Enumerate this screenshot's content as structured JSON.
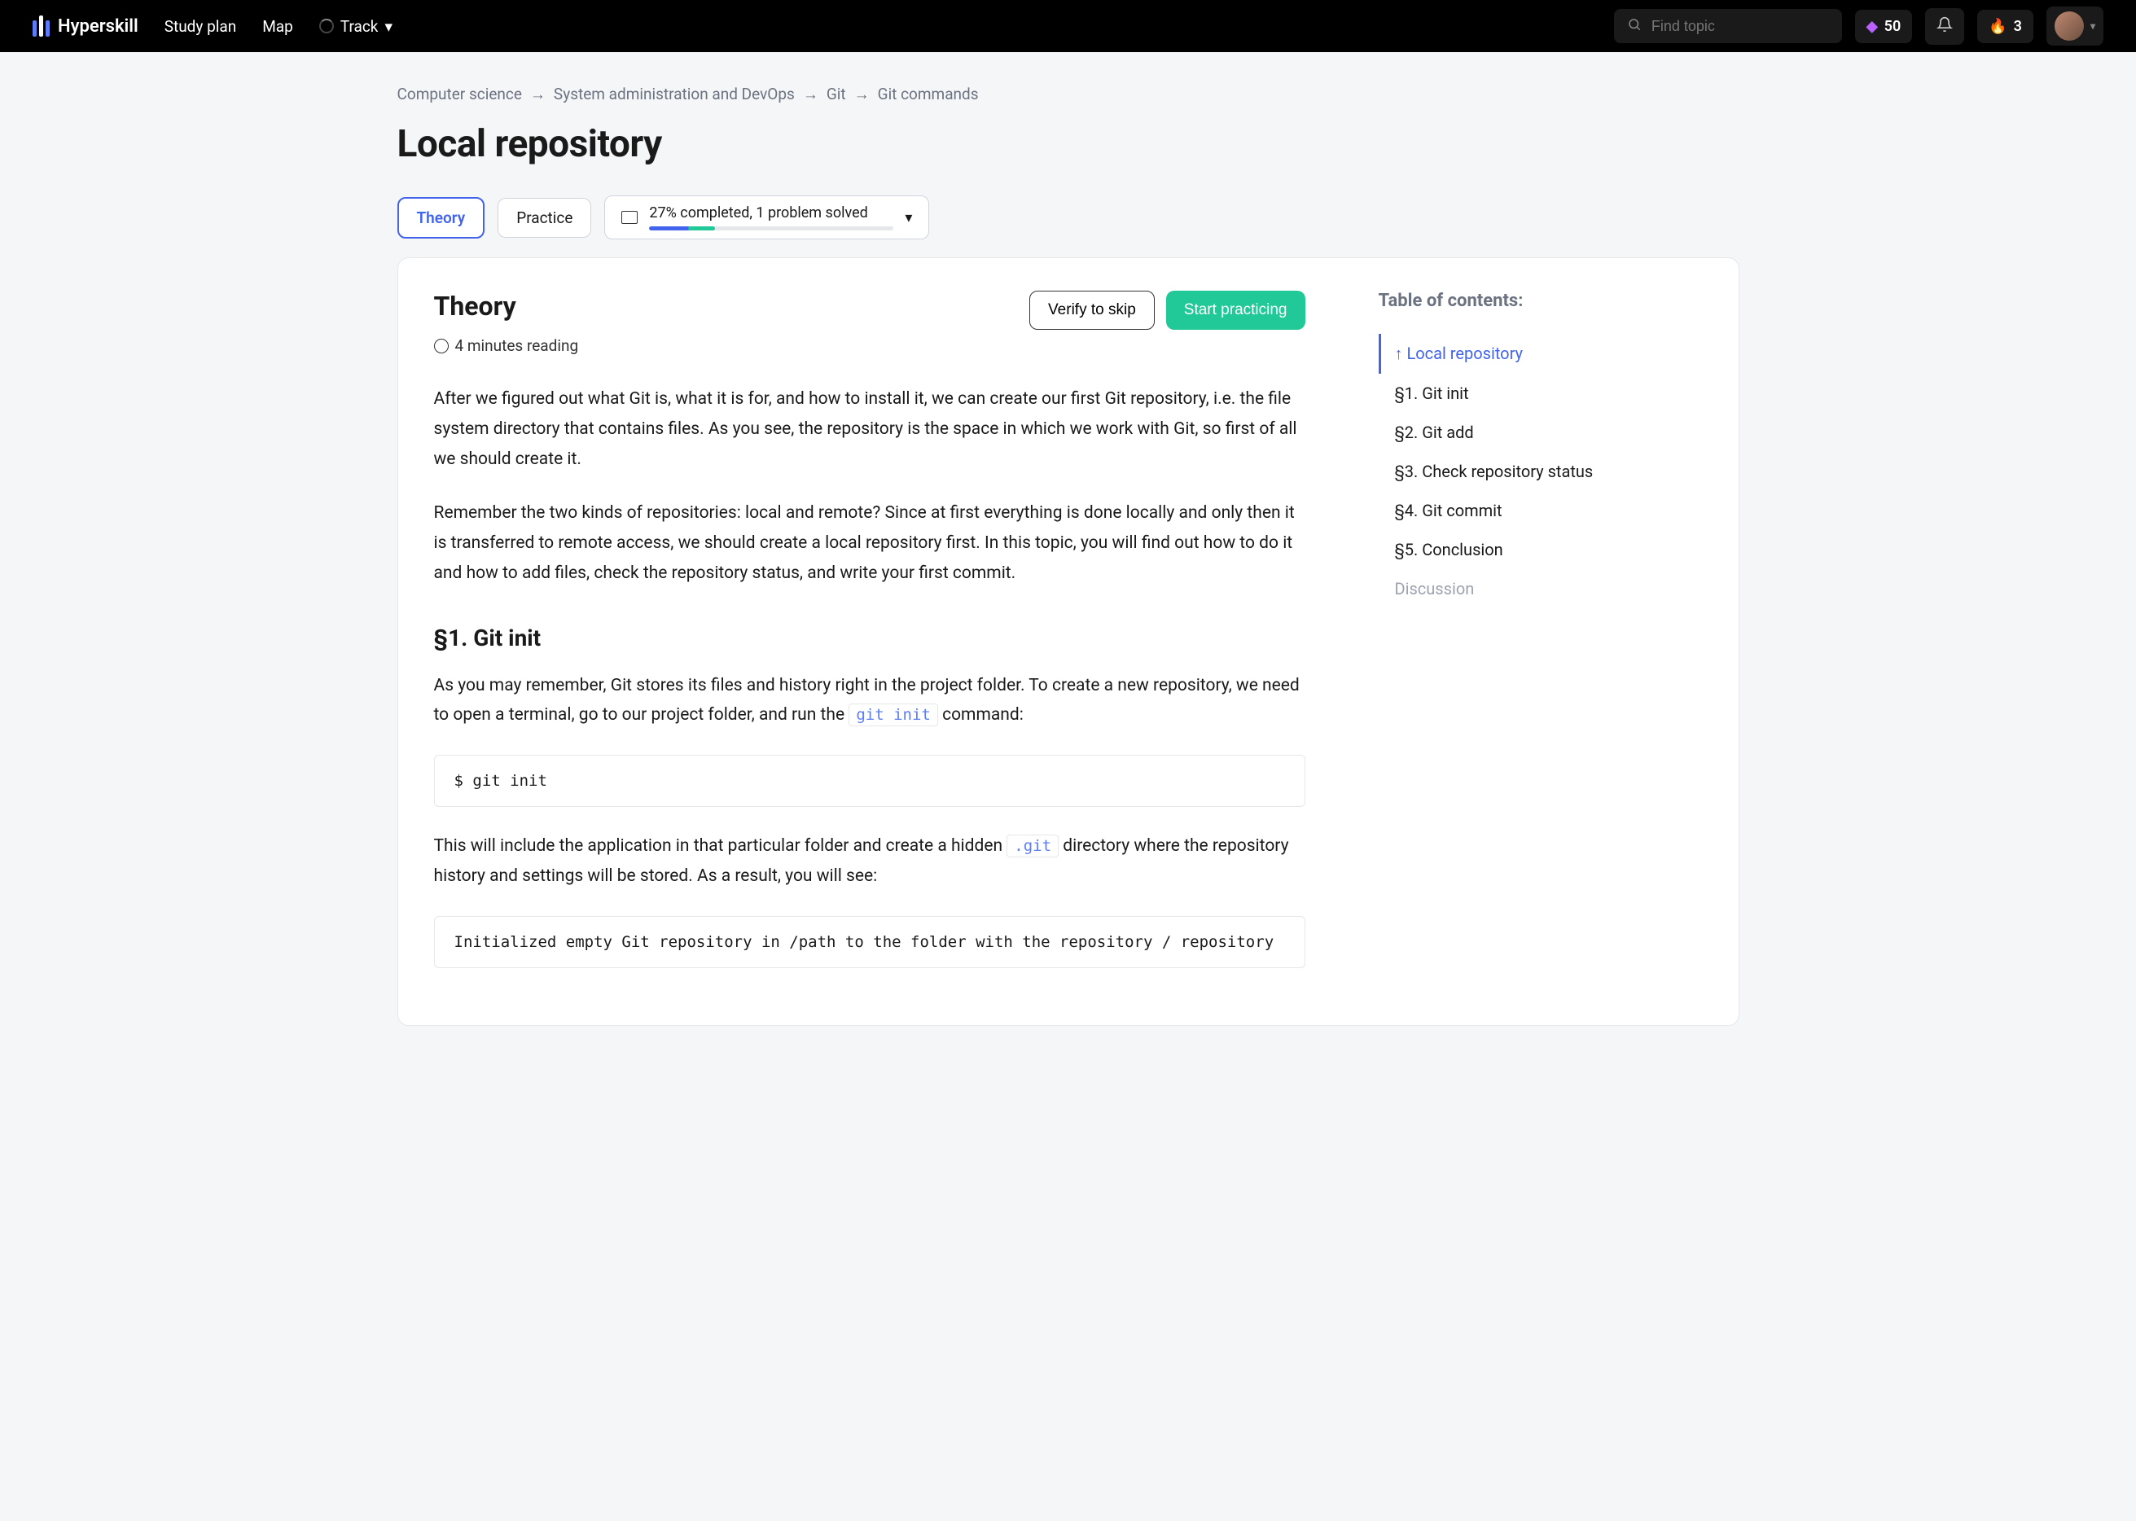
{
  "navbar": {
    "brand": "Hyperskill",
    "links": [
      "Study plan",
      "Map"
    ],
    "track_label": "Track",
    "search_placeholder": "Find topic",
    "gems": "50",
    "streak": "3"
  },
  "breadcrumb": [
    "Computer science",
    "System administration and DevOps",
    "Git",
    "Git commands"
  ],
  "page_title": "Local repository",
  "tabs": {
    "theory": "Theory",
    "practice": "Practice"
  },
  "progress": {
    "text": "27% completed, 1 problem solved",
    "percent": 27
  },
  "theory": {
    "heading": "Theory",
    "verify_btn": "Verify to skip",
    "start_btn": "Start practicing",
    "reading_time": "4 minutes reading",
    "para1": "After we figured out what Git is, what it is for, and how to install it, we can create our first Git repository, i.e. the file system directory that contains files. As you see, the repository is the space in which we work with Git, so first of all we should create it.",
    "para2": "Remember the two kinds of repositories: local and remote? Since at first everything is done locally and only then it is transferred to remote access, we should create a local repository first. In this topic, you will find out how to do it and how to add files, check the repository status, and write your first commit.",
    "sub1_heading": "§1. Git init",
    "sub1_text1_a": "As you may remember, Git stores its files and history right in the project folder. To create a new repository, we need to open a terminal, go to our project folder, and run the ",
    "sub1_code_inline1": "git init",
    "sub1_text1_b": " command:",
    "sub1_codeblock": "$ git init",
    "sub1_text2_a": "This will include the application in that particular folder and create a hidden ",
    "sub1_code_inline2": ".git",
    "sub1_text2_b": " directory where the repository history and settings will be stored. As a result, you will see:",
    "sub1_codeblock2": "Initialized empty Git repository in /path to the folder with the repository / repository"
  },
  "toc": {
    "title": "Table of contents:",
    "items": [
      {
        "label": "↑ Local repository",
        "active": true
      },
      {
        "label": "§1. Git init"
      },
      {
        "label": "§2. Git add"
      },
      {
        "label": "§3. Check repository status"
      },
      {
        "label": "§4. Git commit"
      },
      {
        "label": "§5. Conclusion"
      },
      {
        "label": "Discussion",
        "muted": true
      }
    ]
  }
}
